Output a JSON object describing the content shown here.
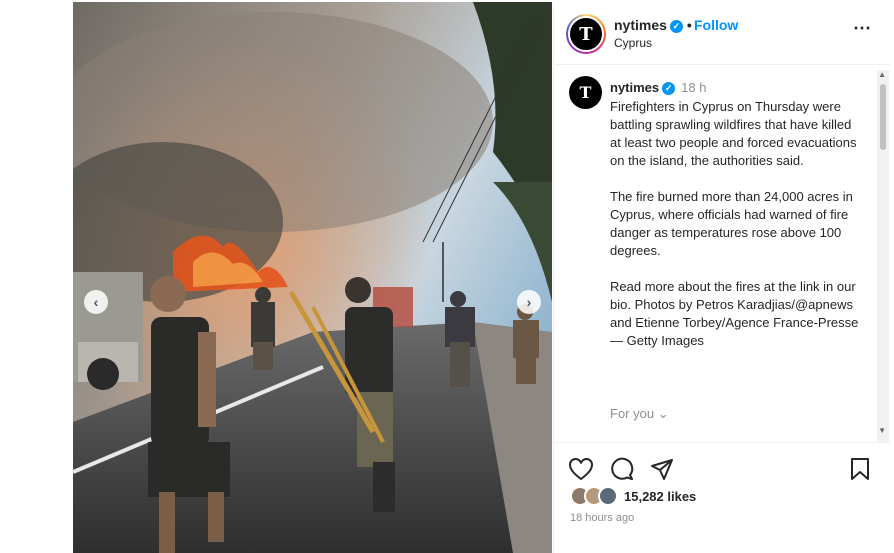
{
  "post": {
    "username": "nytimes",
    "avatar_letter": "T",
    "follow_label": "Follow",
    "location": "Cyprus",
    "more_icon": "⋯"
  },
  "caption": {
    "username": "nytimes",
    "time": "18 h",
    "paragraphs": [
      "Firefighters in Cyprus on Thursday were battling sprawling wildfires that have killed at least two people and forced evacuations on the island, the authorities said.",
      "The fire burned more than 24,000 acres in Cyprus, where officials had warned of fire danger as temperatures rose above 100 degrees.",
      "Read more about the fires at the link in our bio. Photos by Petros Karadjias/@apnews and Etienne Torbey/Agence France-Presse — Getty Images"
    ],
    "for_you": "For you"
  },
  "engagement": {
    "likes": "15,282 likes",
    "posted": "18 hours ago"
  },
  "icons": {
    "like": "heart-icon",
    "comment": "comment-icon",
    "share": "share-icon",
    "save": "bookmark-icon"
  },
  "colors": {
    "follow": "#0095f6",
    "verified": "#0095f6"
  }
}
